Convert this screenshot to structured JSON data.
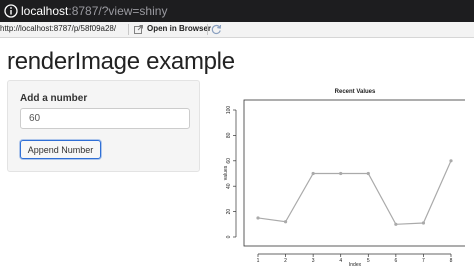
{
  "browser": {
    "url_host": "localhost",
    "url_rest": ":8787/?view=shiny",
    "icon": "info-icon"
  },
  "viewer_toolbar": {
    "url": "http://localhost:8787/p/58f09a28/",
    "open_label": "Open in Browser",
    "open_icon": "open-external-icon",
    "refresh_icon": "refresh-icon"
  },
  "app": {
    "title": "renderImage example",
    "input_label": "Add a number",
    "input_value": "60",
    "button_label": "Append Number"
  },
  "chart_data": {
    "type": "line",
    "title": "Recent Values",
    "xlabel": "Index",
    "ylabel": "values",
    "x": [
      1,
      2,
      3,
      4,
      5,
      6,
      7,
      8
    ],
    "y": [
      15,
      12,
      50,
      50,
      50,
      10,
      11,
      60
    ],
    "xlim": [
      1,
      8
    ],
    "ylim": [
      0,
      100
    ],
    "x_ticks": [
      "1",
      "2",
      "3",
      "4",
      "5",
      "6",
      "7",
      "8"
    ],
    "y_ticks": [
      "0",
      "20",
      "40",
      "60",
      "80",
      "100"
    ],
    "grid": false,
    "line_color": "#aaaaaa",
    "point_color": "#aaaaaa"
  }
}
